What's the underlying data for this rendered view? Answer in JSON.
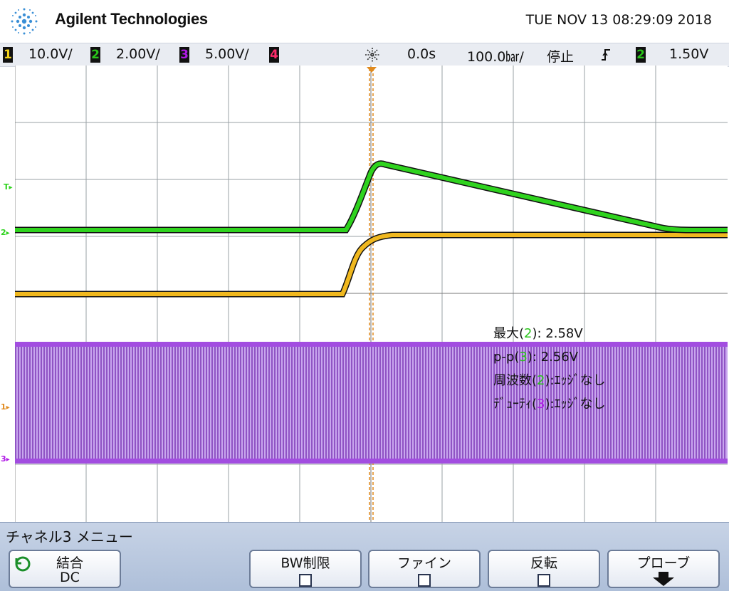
{
  "header": {
    "brand": "Agilent Technologies",
    "datetime": "TUE NOV 13 08:29:09 2018"
  },
  "status": {
    "ch1": {
      "num": "1",
      "scale": "10.0V/",
      "color": "#f2d21a"
    },
    "ch2": {
      "num": "2",
      "scale": "2.00V/",
      "color": "#29c41a"
    },
    "ch3": {
      "num": "3",
      "scale": "5.00V/",
      "color": "#b018e6"
    },
    "ch4": {
      "num": "4",
      "color": "#ff2a6a"
    },
    "trigger_icon": "trigger-star-icon",
    "delay": "0.0s",
    "timebase": "100.0㍴/",
    "run_state": "停止",
    "trigger_slope_icon": "rising-edge-icon",
    "trigger_ch": "2",
    "trigger_level": "1.50V"
  },
  "markers": {
    "trigger": "T",
    "ch2": "2",
    "ch1": "1",
    "ch3": "3"
  },
  "measurements": {
    "max_prefix": "最大(",
    "max_ch": "2",
    "max_value": "): 2.58V",
    "pp_prefix": "p-p(",
    "pp_ch": "3",
    "pp_value": "): 2.56V",
    "freq_prefix": "周波数(",
    "freq_ch": "2",
    "freq_value": "):ｴｯｼﾞなし",
    "duty_prefix": "ﾃﾞｭｰﾃｨ(",
    "duty_ch": "3",
    "duty_value": "):ｴｯｼﾞなし"
  },
  "softkeys": {
    "menu_title": "チャネル3 メニュー",
    "coupling_label": "結合",
    "coupling_value": "DC",
    "bw_limit": "BW制限",
    "fine": "ファイン",
    "invert": "反転",
    "probe": "プローブ"
  }
}
